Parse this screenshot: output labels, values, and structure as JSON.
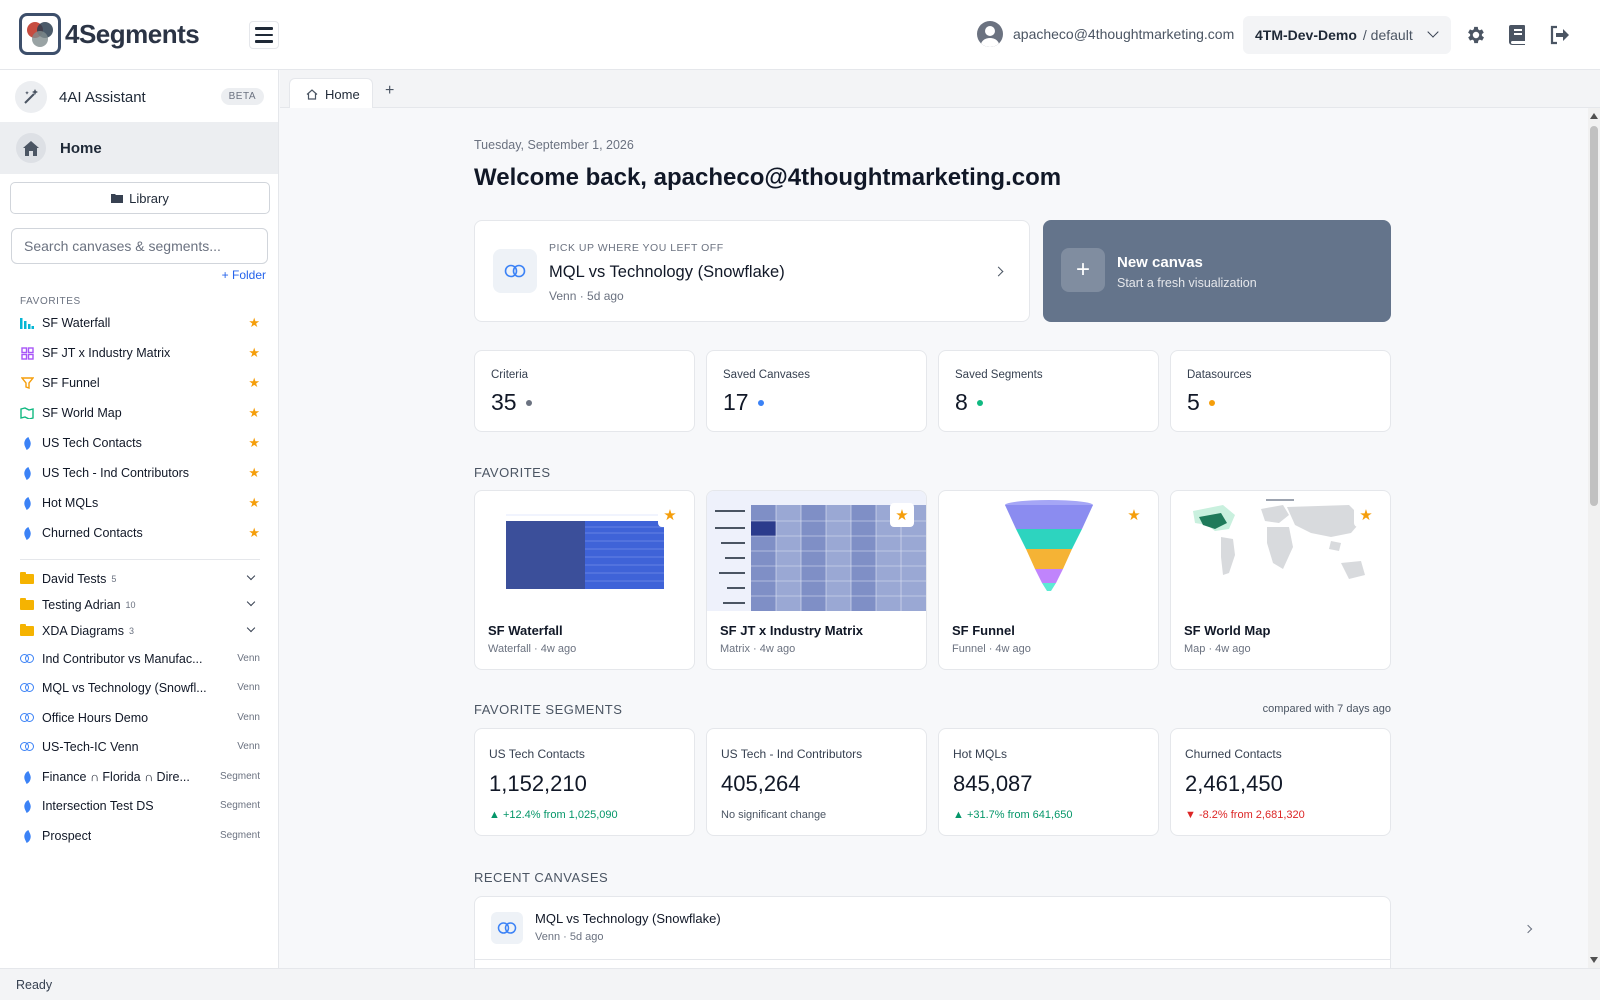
{
  "app": {
    "name": "4Segments"
  },
  "header": {
    "user_email": "apacheco@4thoughtmarketing.com",
    "org_name": "4TM-Dev-Demo",
    "org_scope": "/ default"
  },
  "sidebar": {
    "assistant_label": "4AI Assistant",
    "assistant_badge": "BETA",
    "home_label": "Home",
    "library_label": "Library",
    "search_placeholder": "Search canvases & segments...",
    "add_folder_label": "+ Folder",
    "favorites_header": "FAVORITES",
    "favorites": [
      {
        "label": "SF Waterfall",
        "icon": "waterfall-icon"
      },
      {
        "label": "SF JT x Industry Matrix",
        "icon": "matrix-icon"
      },
      {
        "label": "SF Funnel",
        "icon": "funnel-icon"
      },
      {
        "label": "SF World Map",
        "icon": "map-icon"
      },
      {
        "label": "US Tech Contacts",
        "icon": "segment-icon"
      },
      {
        "label": "US Tech - Ind Contributors",
        "icon": "segment-icon"
      },
      {
        "label": "Hot MQLs",
        "icon": "segment-icon"
      },
      {
        "label": "Churned Contacts",
        "icon": "segment-icon"
      }
    ],
    "folders": [
      {
        "label": "David Tests",
        "count": "5"
      },
      {
        "label": "Testing Adrian",
        "count": "10"
      },
      {
        "label": "XDA Diagrams",
        "count": "3"
      }
    ],
    "items": [
      {
        "label": "Ind Contributor vs Manufac...",
        "type": "Venn"
      },
      {
        "label": "MQL vs Technology (Snowfl...",
        "type": "Venn"
      },
      {
        "label": "Office Hours Demo",
        "type": "Venn"
      },
      {
        "label": "US-Tech-IC Venn",
        "type": "Venn"
      },
      {
        "label": "Finance ∩ Florida ∩ Dire...",
        "type": "Segment"
      },
      {
        "label": "Intersection Test DS",
        "type": "Segment"
      },
      {
        "label": "Prospect",
        "type": "Segment"
      }
    ]
  },
  "tabs": [
    {
      "label": "Home"
    }
  ],
  "tab_add_label": "+",
  "main": {
    "date": "Tuesday, September 1, 2026",
    "welcome": "Welcome back, apacheco@4thoughtmarketing.com",
    "pickup": {
      "eyebrow": "PICK UP WHERE YOU LEFT OFF",
      "title": "MQL vs Technology (Snowflake)",
      "meta": "Venn · 5d ago"
    },
    "new_canvas": {
      "plus": "+",
      "title": "New canvas",
      "subtitle": "Start a fresh visualization"
    },
    "stats": [
      {
        "label": "Criteria",
        "value": "35",
        "dot_color": "#6b7280"
      },
      {
        "label": "Saved Canvases",
        "value": "17",
        "dot_color": "#3b82f6"
      },
      {
        "label": "Saved Segments",
        "value": "8",
        "dot_color": "#10b981"
      },
      {
        "label": "Datasources",
        "value": "5",
        "dot_color": "#f59e0b"
      }
    ],
    "favorites_title": "FAVORITES",
    "favorites": [
      {
        "title": "SF Waterfall",
        "meta": "Waterfall · 4w ago"
      },
      {
        "title": "SF JT x Industry Matrix",
        "meta": "Matrix · 4w ago"
      },
      {
        "title": "SF Funnel",
        "meta": "Funnel · 4w ago"
      },
      {
        "title": "SF World Map",
        "meta": "Map · 4w ago"
      }
    ],
    "segments_title": "FAVORITE SEGMENTS",
    "segments_compare": "compared with 7 days ago",
    "segments": [
      {
        "label": "US Tech Contacts",
        "value": "1,152,210",
        "change": "▲ +12.4% from 1,025,090",
        "trend": "up"
      },
      {
        "label": "US Tech - Ind Contributors",
        "value": "405,264",
        "change": "No significant change",
        "trend": "neutral"
      },
      {
        "label": "Hot MQLs",
        "value": "845,087",
        "change": "▲ +31.7% from 641,650",
        "trend": "up"
      },
      {
        "label": "Churned Contacts",
        "value": "2,461,450",
        "change": "▼ -8.2% from 2,681,320",
        "trend": "down"
      }
    ],
    "recent_title": "RECENT CANVASES",
    "recent": [
      {
        "title": "MQL vs Technology (Snowflake)",
        "meta": "Venn · 5d ago"
      }
    ]
  },
  "status": "Ready",
  "colors": {
    "accent": "#2563eb",
    "star": "#f59e0b",
    "new_canvas_bg": "#64748b",
    "up": "#059669",
    "down": "#dc2626"
  }
}
